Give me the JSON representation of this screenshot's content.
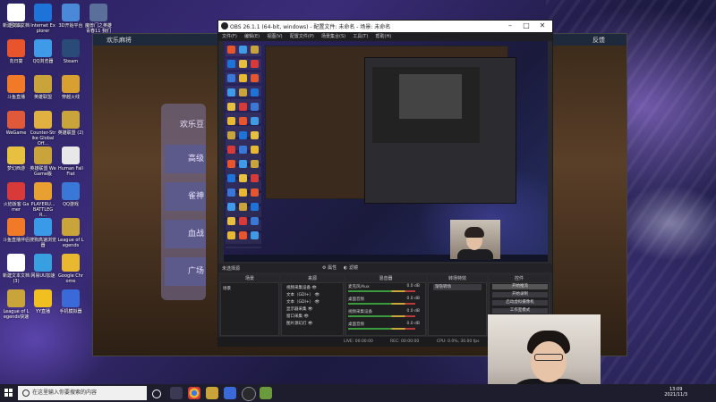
{
  "desktop": {
    "icons": [
      {
        "label": "回收站",
        "color": "#cfd8e6"
      },
      {
        "label": "Internet Explorer",
        "color": "#1e73d8"
      },
      {
        "label": "3D开始平台",
        "color": "#4a88d8"
      },
      {
        "label": "魔兽门之英雄 青春11 我们",
        "color": "#5a6f9a"
      },
      {
        "label": "新建文本文档",
        "color": "#ffffff"
      },
      {
        "label": "向日葵",
        "color": "#e8542c"
      },
      {
        "label": "QQ浏览器",
        "color": "#3f9be8"
      },
      {
        "label": "Steam",
        "color": "#2a4a78"
      },
      {
        "label": "斗鱼直播",
        "color": "#f07a28"
      },
      {
        "label": "英雄联盟",
        "color": "#c9a43a"
      },
      {
        "label": "穿越火线",
        "color": "#d8a030"
      },
      {
        "label": "WeGame",
        "color": "#e05a3a"
      },
      {
        "label": "Counter-Strike Global Off...",
        "color": "#e0b040"
      },
      {
        "label": "英雄联盟 (2)",
        "color": "#c9a43a"
      },
      {
        "label": "梦幻西游",
        "color": "#e8c040"
      },
      {
        "label": "英雄联盟 WeGame版",
        "color": "#c9a43a"
      },
      {
        "label": "Human Fall Flat",
        "color": "#e8e8e8"
      },
      {
        "label": "火焰饭客 Gamer",
        "color": "#d83a3a"
      },
      {
        "label": "PLAYERU... BATTLEGR...",
        "color": "#e8a030"
      },
      {
        "label": "QQ游戏",
        "color": "#3a78d8"
      },
      {
        "label": "斗鱼直播伴侣",
        "color": "#f07a28"
      },
      {
        "label": "搜狗高速浏览器",
        "color": "#3a9ae8"
      },
      {
        "label": "League of Legends",
        "color": "#c9a43a"
      },
      {
        "label": "新建文本文档 (3)",
        "color": "#ffffff"
      },
      {
        "label": "网易UU加速",
        "color": "#38a0e0"
      },
      {
        "label": "Google Chrome",
        "color": "#e8b830"
      },
      {
        "label": "League of Legends快速",
        "color": "#c9a43a"
      },
      {
        "label": "YY直播",
        "color": "#f0c020"
      },
      {
        "label": "手机模拟器",
        "color": "#3a6ad8"
      }
    ]
  },
  "game_window": {
    "title": "欢乐麻将",
    "title_right": "反馈",
    "menu": [
      "欢乐豆",
      "高级",
      "雀神",
      "血战",
      "广场"
    ]
  },
  "obs": {
    "title": "OBS 26.1.1 (64-bit, windows) - 配置文件: 未命名 - 场景: 未命名",
    "window_controls": {
      "minimize": "–",
      "maximize": "□",
      "close": "✕"
    },
    "menu": [
      "文件(F)",
      "编辑(E)",
      "视图(V)",
      "配置文件(P)",
      "场景集合(S)",
      "工具(T)",
      "帮助(H)"
    ],
    "source_bar": {
      "label": "未选择源",
      "properties": "属性",
      "filters": "滤镜"
    },
    "docks": {
      "scenes": {
        "title": "场景",
        "items": [
          "场景"
        ]
      },
      "sources": {
        "title": "来源",
        "items": [
          "视频采集设备",
          "文本（GDI+）",
          "文本（GDI+）",
          "显示器采集",
          "窗口采集",
          "图片源幻灯"
        ]
      },
      "mixer": {
        "title": "混音器",
        "rows": [
          {
            "name": "麦克风/Aux",
            "value": "0.0 dB"
          },
          {
            "name": "桌面音频",
            "value": "0.0 dB"
          },
          {
            "name": "视频采集设备",
            "value": "0.0 dB"
          },
          {
            "name": "桌面音频",
            "value": "0.0 dB"
          }
        ]
      },
      "transitions": {
        "title": "转场特效",
        "selected": "渐隐转场"
      },
      "controls": {
        "title": "控件",
        "buttons": [
          "开始推流",
          "开始录制",
          "启动虚拟摄像机",
          "工作室模式"
        ]
      }
    },
    "status": {
      "live": "LIVE: 00:00:00",
      "rec": "REC: 00:00:00",
      "cpu": "CPU: 0.0%, 30.00 fps"
    }
  },
  "taskbar": {
    "search_placeholder": "在这里输入你要搜索的内容",
    "time": "13:09",
    "date": "2021/11/3"
  }
}
